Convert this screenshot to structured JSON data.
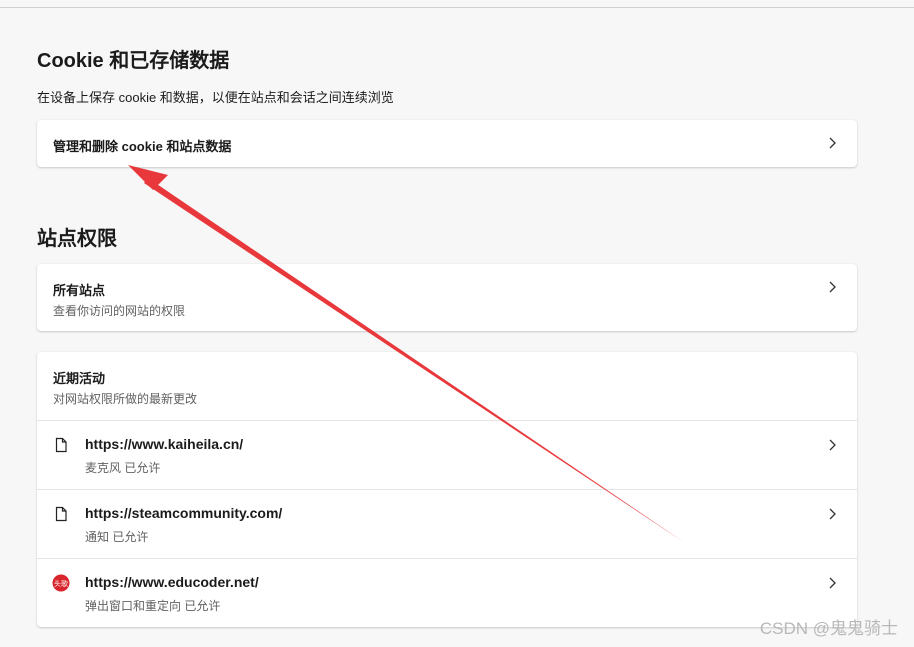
{
  "cookies_section": {
    "title": "Cookie 和已存储数据",
    "description": "在设备上保存 cookie 和数据，以便在站点和会话之间连续浏览",
    "manage_label": "管理和删除 cookie 和站点数据"
  },
  "permissions_section": {
    "title": "站点权限",
    "all_sites": {
      "title": "所有站点",
      "subtitle": "查看你访问的网站的权限"
    },
    "recent_activity": {
      "title": "近期活动",
      "subtitle": "对网站权限所做的最新更改",
      "items": [
        {
          "url": "https://www.kaiheila.cn/",
          "detail": "麦克风 已允许",
          "icon": "page-icon"
        },
        {
          "url": "https://steamcommunity.com/",
          "detail": "通知 已允许",
          "icon": "page-icon"
        },
        {
          "url": "https://www.educoder.net/",
          "detail": "弹出窗口和重定向 已允许",
          "icon": "educoder-favicon",
          "favicon_text": "头歌"
        }
      ]
    }
  },
  "watermark": "CSDN @鬼鬼骑士",
  "colors": {
    "annotation_arrow": "#e8383b",
    "background": "#f7f7f7"
  }
}
